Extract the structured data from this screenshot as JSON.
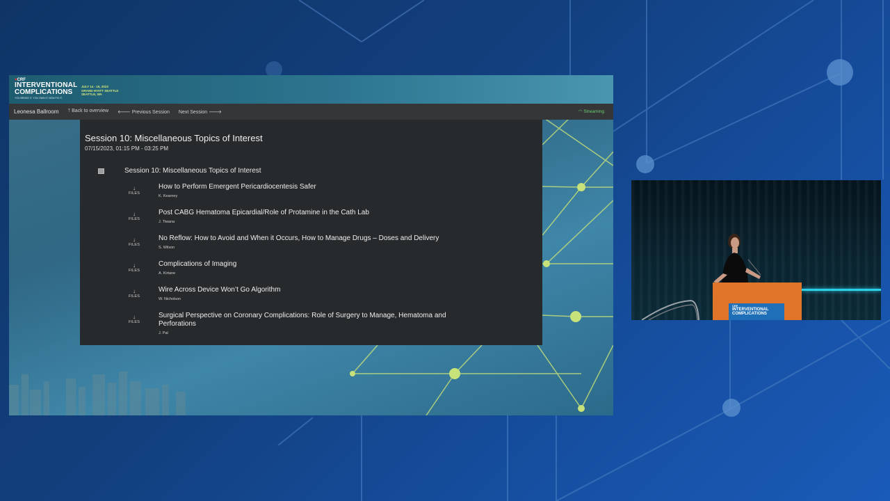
{
  "slide": {
    "logo": {
      "crf": "CRF",
      "line1": "INTERVENTIONAL",
      "line2": "COMPLICATIONS",
      "tagline": "YOU BROKE IT. YOU OWN IT. NOW FIX IT."
    },
    "event": {
      "dates": "JULY 14 - 15, 2023",
      "venue": "GRAND HYATT SEATTLE",
      "city": "SEATTLE, WA"
    }
  },
  "navbar": {
    "room": "Leonesa Ballroom",
    "back": "Back to overview",
    "previous": "Previous Session",
    "next": "Next Session",
    "status": "Streaming"
  },
  "session": {
    "title": "Session 10: Miscellaneous Topics of Interest",
    "datetime": "07/15/2023, 01:15 PM - 03:25 PM",
    "section_title": "Session 10: Miscellaneous Topics of Interest",
    "files_label": "FILES",
    "talks": [
      {
        "title": "How to Perform Emergent Pericardiocentesis Safer",
        "speaker": "K. Kearney"
      },
      {
        "title": "Post CABG Hematoma Epicardial/Role of Protamine in the Cath Lab",
        "speaker": "J. Tiwana"
      },
      {
        "title": "No Reflow: How to Avoid and When it Occurs, How to Manage Drugs – Doses and Delivery",
        "speaker": "S. Wilson"
      },
      {
        "title": "Complications of Imaging",
        "speaker": "A. Kirtane"
      },
      {
        "title": "Wire Across Device Won’t Go Algorithm",
        "speaker": "W. Nicholson"
      },
      {
        "title": "Surgical Perspective on Coronary Complications: Role of Surgery to Manage, Hematoma and Perforations",
        "speaker": "J. Pal"
      }
    ]
  },
  "video": {
    "podium_crf": "CRF",
    "podium_line1": "INTERVENTIONAL",
    "podium_line2": "COMPLICATIONS"
  },
  "colors": {
    "streaming": "#6fcf6f",
    "podium": "#e0752a",
    "accent_lime": "#c8e27a",
    "background_blue": "#1650a3"
  }
}
